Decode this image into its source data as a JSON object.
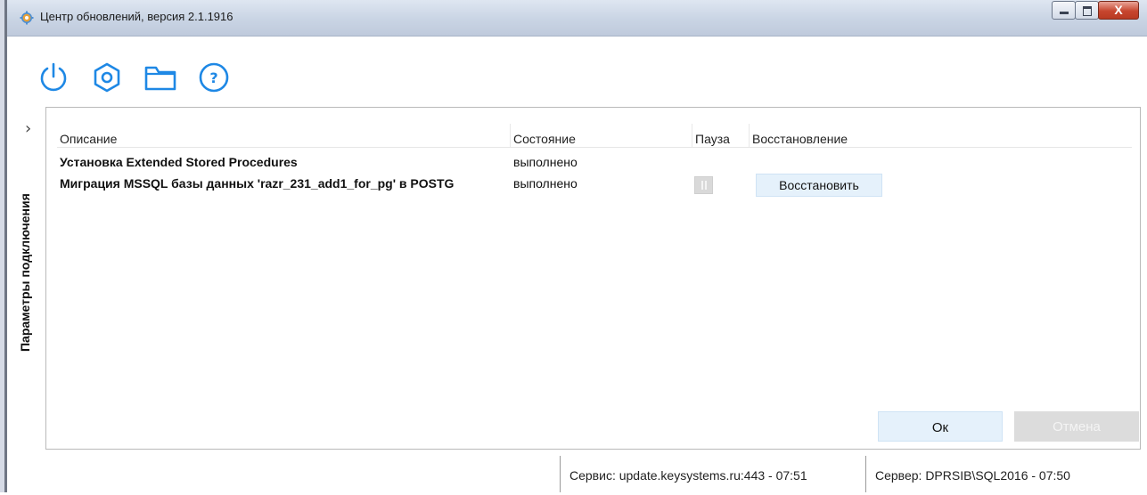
{
  "window": {
    "title": "Центр обновлений, версия 2.1.1916",
    "close_glyph": "X"
  },
  "toolbar": {
    "icons": [
      "power-icon",
      "settings-hex-icon",
      "folder-icon",
      "help-icon"
    ],
    "accent": "#1e88e5"
  },
  "side_panel": {
    "label": "Параметры подключения",
    "chevron": "›"
  },
  "grid": {
    "columns": [
      "Описание",
      "Состояние",
      "Пауза",
      "Восстановление"
    ],
    "rows": [
      {
        "description": "Установка Extended Stored Procedures",
        "state": "выполнено",
        "pause": false,
        "restore": ""
      },
      {
        "description": "Миграция MSSQL базы данных 'razr_231_add1_for_pg' в POSTG",
        "state": "выполнено",
        "pause": true,
        "restore": "Восстановить"
      }
    ]
  },
  "buttons": {
    "ok": "Ок",
    "cancel": "Отмена"
  },
  "status": {
    "service": "Сервис:   update.keysystems.ru:443 - 07:51",
    "server": "Сервер:   DPRSIB\\SQL2016 - 07:50"
  }
}
